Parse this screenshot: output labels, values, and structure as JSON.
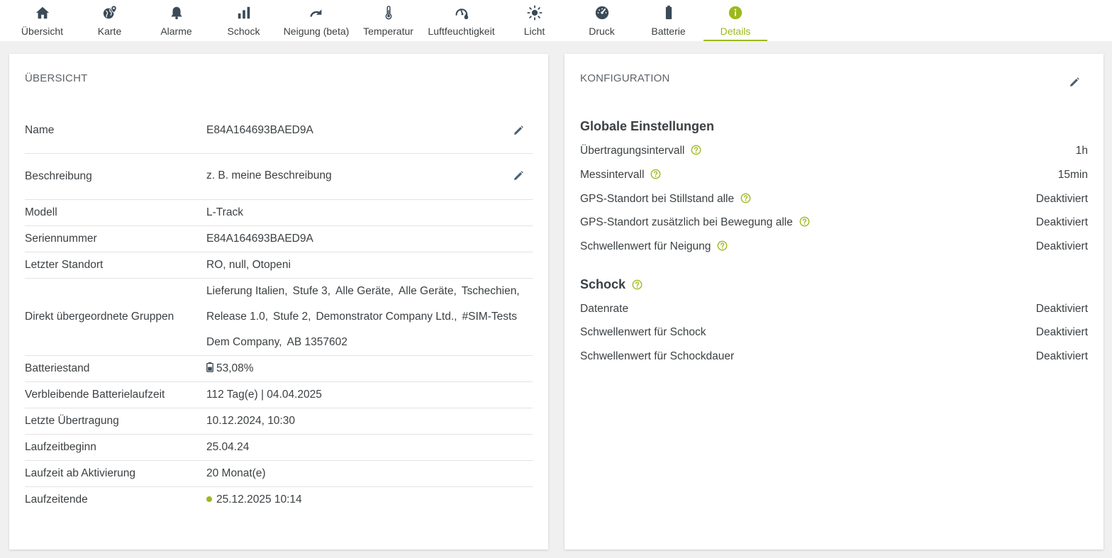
{
  "colors": {
    "accent": "#9cba1c",
    "icon": "#3c4a57",
    "text": "#3c4043",
    "divider": "#e3e3e3"
  },
  "tabs": [
    {
      "label": "Übersicht",
      "icon": "home-icon"
    },
    {
      "label": "Karte",
      "icon": "globe-pin-icon"
    },
    {
      "label": "Alarme",
      "icon": "bell-icon"
    },
    {
      "label": "Schock",
      "icon": "bar-chart-icon"
    },
    {
      "label": "Neigung (beta)",
      "icon": "redo-arrow-icon"
    },
    {
      "label": "Temperatur",
      "icon": "thermometer-icon"
    },
    {
      "label": "Luftfeuchtigkeit",
      "icon": "gauge-drop-icon"
    },
    {
      "label": "Licht",
      "icon": "sun-icon"
    },
    {
      "label": "Druck",
      "icon": "speedometer-icon"
    },
    {
      "label": "Batterie",
      "icon": "battery-icon"
    },
    {
      "label": "Details",
      "icon": "info-icon",
      "active": true
    }
  ],
  "overview": {
    "title": "ÜBERSICHT",
    "rows": [
      {
        "key": "Name",
        "value": "E84A164693BAED9A"
      },
      {
        "key": "Beschreibung",
        "value": "z. B. meine Beschreibung"
      },
      {
        "key": "Modell",
        "value": "L-Track"
      },
      {
        "key": "Seriennummer",
        "value": "E84A164693BAED9A"
      },
      {
        "key": "Letzter Standort",
        "value": "RO, null, Otopeni"
      },
      {
        "key": "Direkt übergeordnete Gruppen",
        "groups": [
          [
            "Lieferung Italien,",
            "Stufe 3,",
            "Alle Geräte,",
            "Alle Geräte,",
            "Tschechien,"
          ],
          [
            "Release 1.0,",
            "Stufe 2,",
            "Demonstrator Company Ltd.,",
            "#SIM-Tests"
          ],
          [
            "Dem Company,",
            "AB 1357602"
          ]
        ]
      },
      {
        "key": "Batteriestand",
        "value": "53,08%"
      },
      {
        "key": "Verbleibende Batterielaufzeit",
        "value": "112 Tag(e) | 04.04.2025"
      },
      {
        "key": "Letzte Übertragung",
        "value": "10.12.2024, 10:30"
      },
      {
        "key": "Laufzeitbeginn",
        "value": "25.04.24"
      },
      {
        "key": "Laufzeit ab Aktivierung",
        "value": "20 Monat(e)"
      },
      {
        "key": "Laufzeitende",
        "value": "25.12.2025 10:14"
      }
    ]
  },
  "config": {
    "title": "KONFIGURATION",
    "global": {
      "title": "Globale Einstellungen",
      "rows": [
        {
          "key": "Übertragungsintervall",
          "value": "1h"
        },
        {
          "key": "Messintervall",
          "value": "15min"
        },
        {
          "key": "GPS-Standort bei Stillstand alle",
          "value": "Deaktiviert"
        },
        {
          "key": "GPS-Standort zusätzlich bei Bewegung alle",
          "value": "Deaktiviert"
        },
        {
          "key": "Schwellenwert für Neigung",
          "value": "Deaktiviert"
        }
      ]
    },
    "shock": {
      "title": "Schock",
      "rows": [
        {
          "key": "Datenrate",
          "value": "Deaktiviert"
        },
        {
          "key": "Schwellenwert für Schock",
          "value": "Deaktiviert"
        },
        {
          "key": "Schwellenwert für Schockdauer",
          "value": "Deaktiviert"
        }
      ]
    }
  }
}
